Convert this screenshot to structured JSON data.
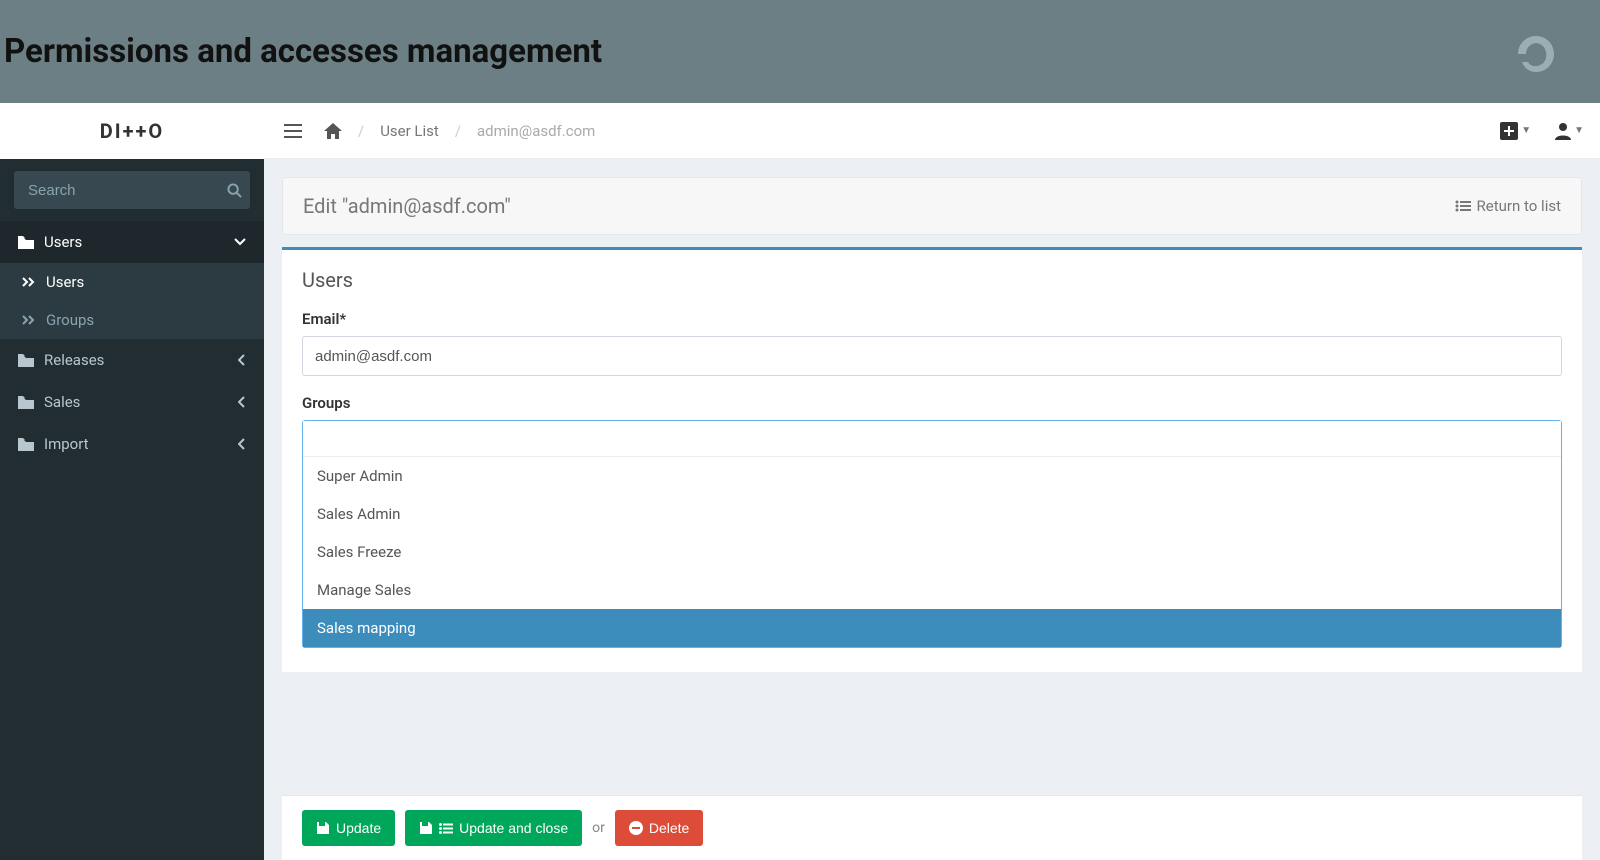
{
  "banner": {
    "title": "Permissions and accesses management"
  },
  "logo": "DI++O",
  "search": {
    "placeholder": "Search"
  },
  "sidebar": {
    "items": [
      {
        "label": "Users",
        "expanded": true,
        "children": [
          {
            "label": "Users",
            "active": true
          },
          {
            "label": "Groups",
            "active": false
          }
        ]
      },
      {
        "label": "Releases"
      },
      {
        "label": "Sales"
      },
      {
        "label": "Import"
      }
    ]
  },
  "breadcrumb": {
    "items": [
      "User List",
      "admin@asdf.com"
    ]
  },
  "panel": {
    "title": "Edit \"admin@asdf.com\"",
    "return": "Return to list",
    "section": "Users",
    "email_label": "Email*",
    "email_value": "admin@asdf.com",
    "groups_label": "Groups",
    "group_options": [
      {
        "label": "Super Admin",
        "highlight": false
      },
      {
        "label": "Sales Admin",
        "highlight": false
      },
      {
        "label": "Sales Freeze",
        "highlight": false
      },
      {
        "label": "Manage Sales",
        "highlight": false
      },
      {
        "label": "Sales mapping",
        "highlight": true
      }
    ]
  },
  "actions": {
    "update": "Update",
    "update_close": "Update and close",
    "or": "or",
    "delete": "Delete"
  }
}
